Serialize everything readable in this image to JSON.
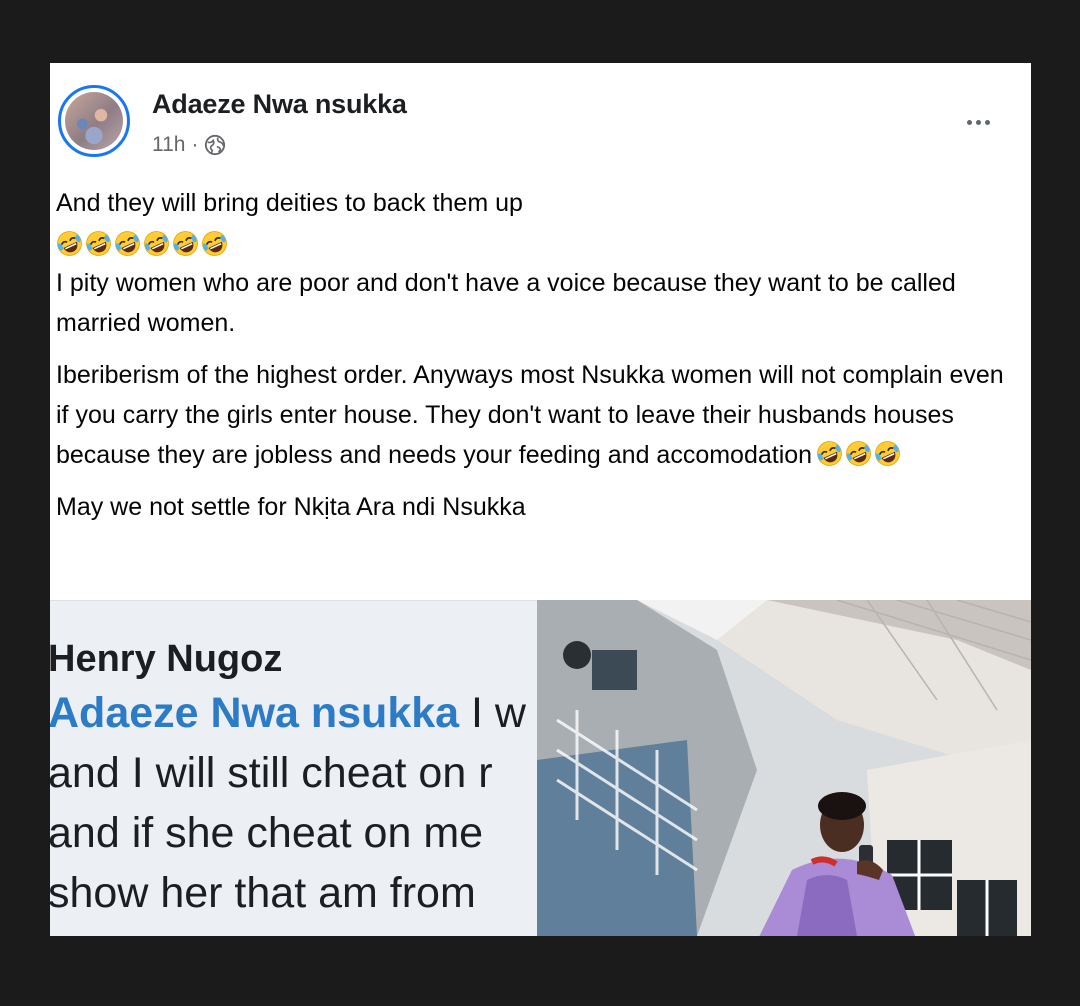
{
  "post": {
    "author": "Adaeze Nwa nsukka",
    "time": "11h",
    "separator": "·",
    "more_label": "More options",
    "paragraphs": [
      "And they will bring deities to back them up",
      "I pity women who are poor and don't have a voice because they want to be called married women.",
      "Iberiberism of the highest order. Anyways most Nsukka women will not complain even if you carry the girls enter house. They don't want to leave their husbands houses because they are jobless and needs your feeding and accomodation",
      "May we not settle for Nkịta Ara ndi Nsukka"
    ],
    "emoji_name": "rolling-on-floor-laughing"
  },
  "comment_screenshot": {
    "commenter": "Henry Nugoz",
    "mention": "Adaeze Nwa nsukka",
    "lines": [
      "I w",
      "and I will still cheat on r",
      "and if she cheat on me",
      "show her that am from"
    ]
  },
  "colors": {
    "background": "#1b1b1b",
    "card": "#ffffff",
    "text": "#050505",
    "secondary": "#65676b",
    "link": "#2b7bc6",
    "avatar_ring": "#1877f2"
  }
}
